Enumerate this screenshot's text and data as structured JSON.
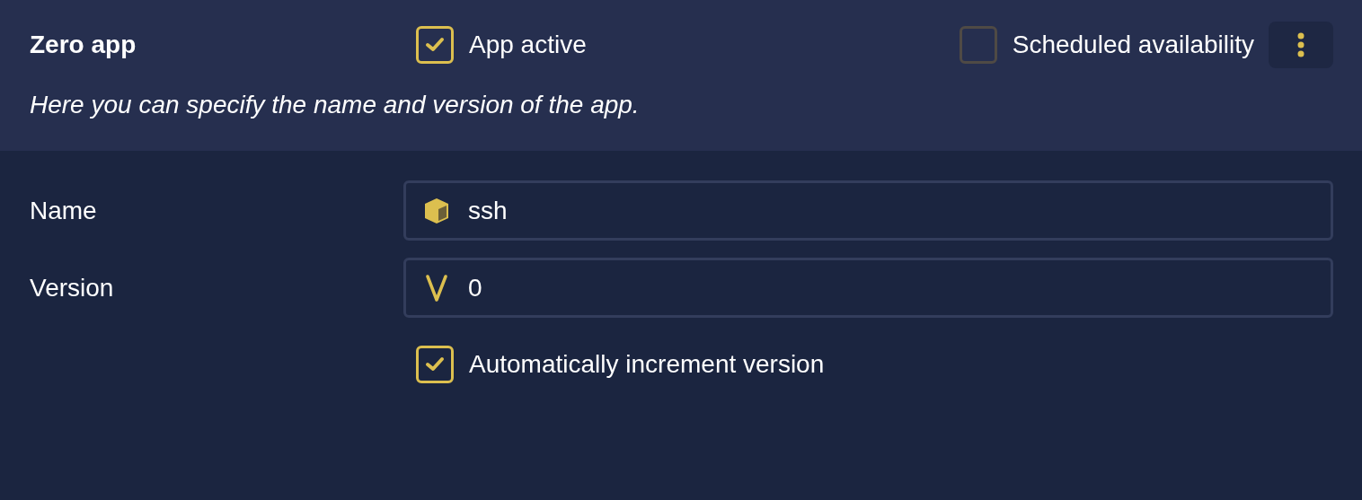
{
  "header": {
    "title": "Zero app",
    "description": "Here you can specify the name and version of the app.",
    "toggles": [
      {
        "label": "App active",
        "checked": true
      },
      {
        "label": "Scheduled availability",
        "checked": false
      }
    ]
  },
  "fields": [
    {
      "label": "Name",
      "kind": "name",
      "value": "ssh"
    },
    {
      "label": "Version",
      "kind": "version",
      "value": "0"
    }
  ],
  "auto_increment": {
    "label": "Automatically increment version",
    "checked": true
  }
}
